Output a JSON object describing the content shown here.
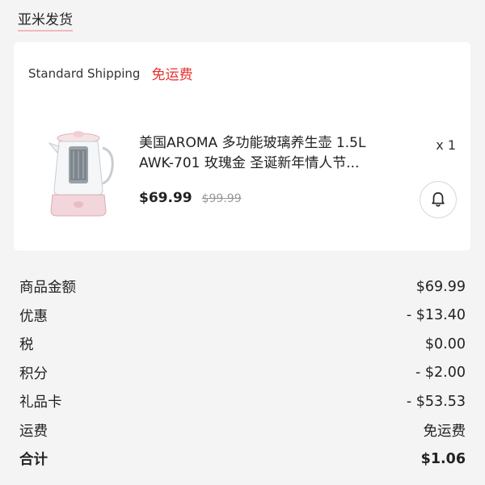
{
  "seller": {
    "name": "亚米发货"
  },
  "shipping": {
    "method": "Standard Shipping",
    "free_label": "免运费"
  },
  "product": {
    "title_line1": "美国AROMA 多功能玻璃养生壶 1.5L",
    "title_line2": "AWK-701 玫瑰金  圣诞新年情人节...",
    "quantity": "x 1",
    "price": "$69.99",
    "original_price": "$99.99",
    "image_icon": "glass-kettle-icon",
    "notify_icon": "bell-icon"
  },
  "summary": {
    "rows": [
      {
        "label": "商品金额",
        "value": "$69.99"
      },
      {
        "label": "优惠",
        "value": "- $13.40"
      },
      {
        "label": "税",
        "value": "$0.00"
      },
      {
        "label": "积分",
        "value": "- $2.00"
      },
      {
        "label": "礼品卡",
        "value": "- $53.53"
      },
      {
        "label": "运费",
        "value": "免运费"
      }
    ],
    "total_label": "合计",
    "total_value": "$1.06"
  },
  "colors": {
    "accent": "#e8312e",
    "underline": "#f3b7bd",
    "background": "#f4f4f4"
  }
}
